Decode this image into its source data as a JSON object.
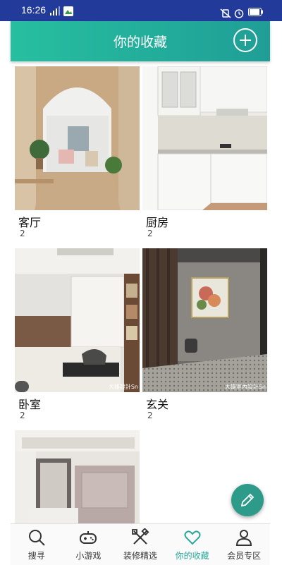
{
  "status": {
    "time": "16:26",
    "left_icons": [
      "signal-data-icon",
      "gallery-notification-icon"
    ],
    "right_icons": [
      "mute-vibrate-icon",
      "alarm-icon",
      "battery-icon"
    ]
  },
  "header": {
    "title": "你的收藏",
    "add_icon": "plus-circle-icon"
  },
  "collections": [
    {
      "name": "客厅",
      "count": "2",
      "watermark": ""
    },
    {
      "name": "厨房",
      "count": "2",
      "watermark": ""
    },
    {
      "name": "卧室",
      "count": "2",
      "watermark": "大雄設計Sn"
    },
    {
      "name": "玄关",
      "count": "2",
      "watermark": "大雄室內設計Sn"
    },
    {
      "name": "",
      "count": "",
      "watermark": ""
    }
  ],
  "fab": {
    "icon": "edit-pencil-icon"
  },
  "tabs": [
    {
      "label": "搜寻",
      "icon": "search-icon",
      "active": false
    },
    {
      "label": "小游戏",
      "icon": "gamepad-icon",
      "active": false
    },
    {
      "label": "装修精选",
      "icon": "tools-icon",
      "active": false
    },
    {
      "label": "你的收藏",
      "icon": "heart-icon",
      "active": true
    },
    {
      "label": "会员专区",
      "icon": "user-icon",
      "active": false
    }
  ],
  "colors": {
    "accent": "#27bfa0",
    "status_bar": "#223a9a",
    "active_tab": "#2aa89a"
  }
}
